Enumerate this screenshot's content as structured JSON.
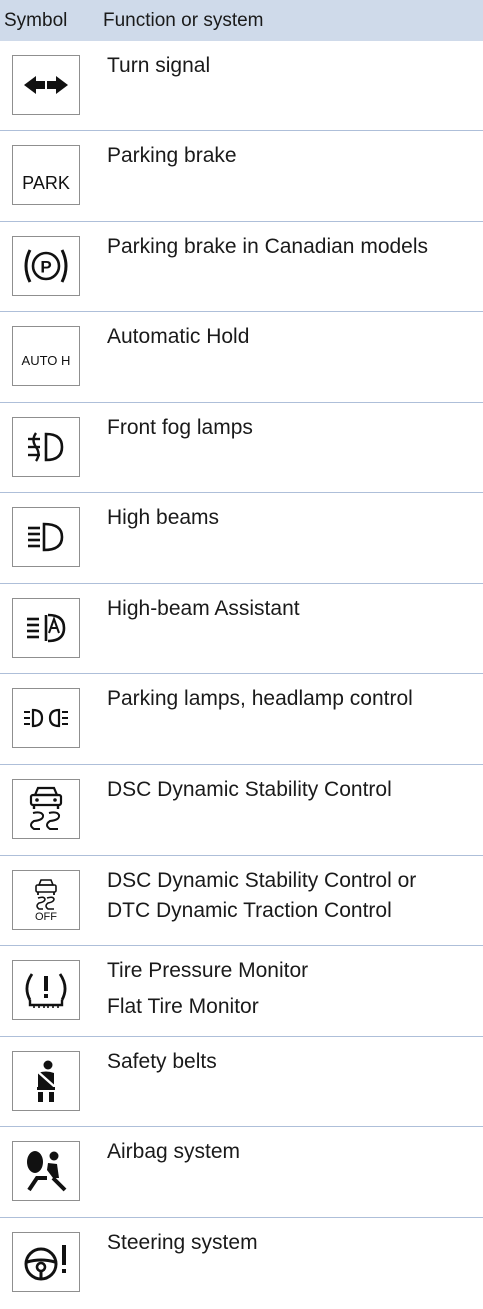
{
  "header": {
    "symbol": "Symbol",
    "function": "Function or system"
  },
  "icon_text": {
    "park": "PARK",
    "auto_h": "AUTO H",
    "off": "OFF"
  },
  "rows": [
    {
      "icon": "turn-signal-icon",
      "lines": [
        "Turn signal"
      ]
    },
    {
      "icon": "park-text-icon",
      "lines": [
        "Parking brake"
      ]
    },
    {
      "icon": "parking-brake-circle-icon",
      "lines": [
        "Parking brake in Canadian models"
      ]
    },
    {
      "icon": "auto-hold-icon",
      "lines": [
        "Automatic Hold"
      ]
    },
    {
      "icon": "front-fog-lamp-icon",
      "lines": [
        "Front fog lamps"
      ]
    },
    {
      "icon": "high-beam-icon",
      "lines": [
        "High beams"
      ]
    },
    {
      "icon": "high-beam-assistant-icon",
      "lines": [
        "High-beam Assistant"
      ]
    },
    {
      "icon": "parking-lamps-icon",
      "lines": [
        "Parking lamps, headlamp control"
      ]
    },
    {
      "icon": "dsc-icon",
      "lines": [
        "DSC Dynamic Stability Control"
      ]
    },
    {
      "icon": "dsc-off-icon",
      "lines": [
        "DSC Dynamic Stability Control or",
        "DTC Dynamic Traction Control"
      ]
    },
    {
      "icon": "tire-pressure-icon",
      "lines": [
        "Tire Pressure Monitor",
        "Flat Tire Monitor"
      ]
    },
    {
      "icon": "seat-belt-icon",
      "lines": [
        "Safety belts"
      ]
    },
    {
      "icon": "airbag-icon",
      "lines": [
        "Airbag system"
      ]
    },
    {
      "icon": "steering-warning-icon",
      "lines": [
        "Steering system"
      ]
    }
  ]
}
